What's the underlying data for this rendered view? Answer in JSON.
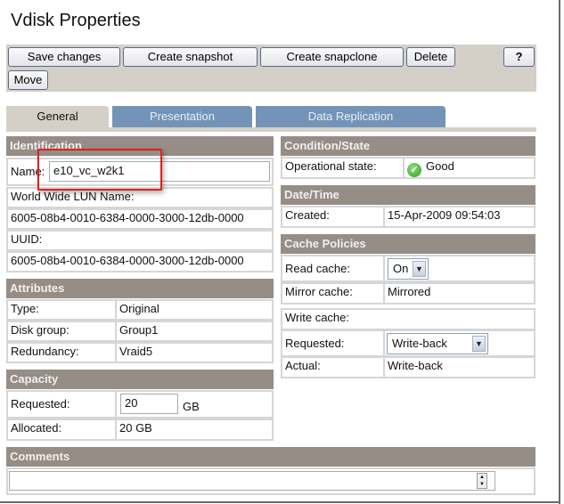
{
  "title": "Vdisk Properties",
  "toolbar": {
    "save": "Save changes",
    "snapshot": "Create snapshot",
    "snapclone": "Create snapclone",
    "delete": "Delete",
    "help": "?",
    "move": "Move"
  },
  "tabs": [
    "General",
    "Presentation",
    "Data Replication"
  ],
  "identification": {
    "header": "Identification",
    "name_label": "Name:",
    "name_value": "e10_vc_w2k1",
    "wwln_label": "World Wide LUN Name:",
    "wwln_value": "6005-08b4-0010-6384-0000-3000-12db-0000",
    "uuid_label": "UUID:",
    "uuid_value": "6005-08b4-0010-6384-0000-3000-12db-0000"
  },
  "attributes": {
    "header": "Attributes",
    "rows": [
      {
        "label": "Type:",
        "value": "Original"
      },
      {
        "label": "Disk group:",
        "value": "Group1"
      },
      {
        "label": "Redundancy:",
        "value": "Vraid5"
      }
    ]
  },
  "capacity": {
    "header": "Capacity",
    "requested_label": "Requested:",
    "requested_value": "20",
    "unit": "GB",
    "allocated_label": "Allocated:",
    "allocated_value": "20 GB"
  },
  "comments": {
    "header": "Comments",
    "value": ""
  },
  "condition": {
    "header": "Condition/State",
    "label": "Operational state:",
    "value": "Good"
  },
  "datetime": {
    "header": "Date/Time",
    "label": "Created:",
    "value": "15-Apr-2009 09:54:03"
  },
  "cache": {
    "header": "Cache Policies",
    "read_label": "Read cache:",
    "read_value": "On",
    "mirror_label": "Mirror cache:",
    "mirror_value": "Mirrored",
    "write_label": "Write cache:",
    "requested_label": "Requested:",
    "requested_value": "Write-back",
    "actual_label": "Actual:",
    "actual_value": "Write-back"
  }
}
